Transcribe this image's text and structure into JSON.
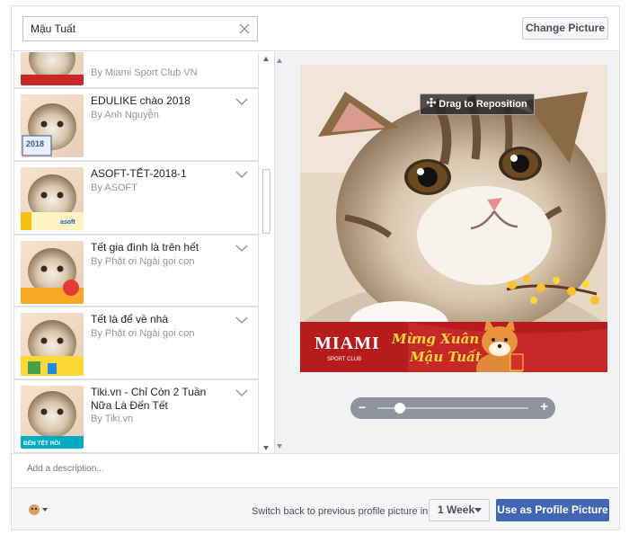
{
  "search": {
    "value": "Mậu Tuất"
  },
  "header": {
    "change_picture": "Change Picture"
  },
  "frames": [
    {
      "title": "",
      "by": "By Miami Sport Club VN",
      "banner": ""
    },
    {
      "title": "EDULIKE chào 2018",
      "by": "By Anh Nguyễn",
      "banner": "2018"
    },
    {
      "title": "ASOFT-TẾT-2018-1",
      "by": "By ASOFT",
      "banner": "asoft"
    },
    {
      "title": "Tết gia đình là trên hết",
      "by": "By Phật ơi Ngài gọi con",
      "banner": ""
    },
    {
      "title": "Tết là để về nhà",
      "by": "By Phật ơi Ngài gọi con",
      "banner": ""
    },
    {
      "title": "Tiki.vn - Chỉ Còn 2 Tuần Nữa Là Đến Tết",
      "by": "By Tiki.vn",
      "banner": "ĐẾN TẾT RỒI"
    }
  ],
  "preview": {
    "drag_label": "Drag to Reposition",
    "brand": "MIAMI",
    "brand_sub": "SPORT CLUB",
    "greeting_line1": "Mừng Xuân",
    "greeting_line2": "Mậu Tuất",
    "zoom_minus": "−",
    "zoom_plus": "+",
    "zoom_level": 0.12
  },
  "description": {
    "placeholder": "Add a description..."
  },
  "footer": {
    "switch_text": "Switch back to previous profile picture in",
    "duration": "1 Week",
    "use_button": "Use as Profile Picture"
  },
  "colors": {
    "accent": "#4267b2",
    "banner_red": "#b71c1c",
    "zoom_track": "#8d949e"
  }
}
